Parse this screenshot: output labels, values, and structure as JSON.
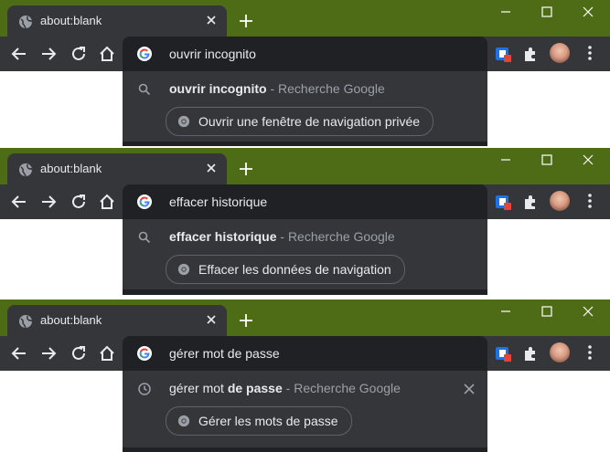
{
  "colors": {
    "frame": "#4e6b16",
    "tab_active": "#35363a",
    "toolbar": "#35363a",
    "omnibox": "#202124",
    "text_primary": "#e8eaed",
    "text_secondary": "#9aa0a6"
  },
  "windows": [
    {
      "tab": {
        "title": "about:blank"
      },
      "omnibox": {
        "value": "ouvrir incognito"
      },
      "suggestion": {
        "icon": "search-icon",
        "text_bold": "ouvrir incognito",
        "text_rest": "",
        "separator": " - ",
        "source": "Recherche Google",
        "removable": false
      },
      "action": {
        "icon": "chrome-icon",
        "label": "Ouvrir une fenêtre de navigation privée"
      }
    },
    {
      "tab": {
        "title": "about:blank"
      },
      "omnibox": {
        "value": "effacer historique"
      },
      "suggestion": {
        "icon": "search-icon",
        "text_bold": "effacer historique",
        "text_rest": "",
        "separator": " - ",
        "source": "Recherche Google",
        "removable": false
      },
      "action": {
        "icon": "chrome-icon",
        "label": "Effacer les données de navigation"
      }
    },
    {
      "tab": {
        "title": "about:blank"
      },
      "omnibox": {
        "value": "gérer mot de passe"
      },
      "suggestion": {
        "icon": "history-clock-icon",
        "text_plain": "gérer mot ",
        "text_bold": "de passe",
        "separator": " - ",
        "source": "Recherche Google",
        "removable": true
      },
      "action": {
        "icon": "chrome-icon",
        "label": "Gérer les mots de passe"
      }
    }
  ]
}
